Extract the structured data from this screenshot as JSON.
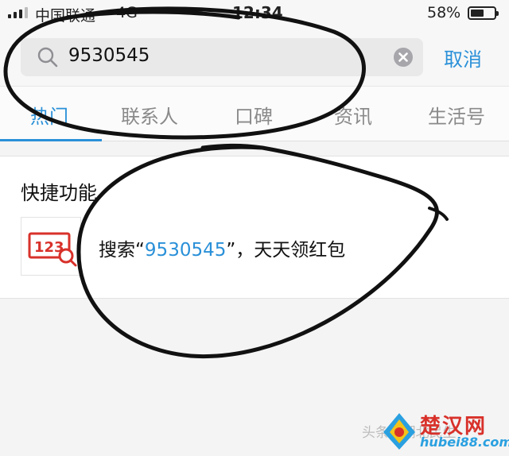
{
  "status_bar": {
    "carrier": "中国联通",
    "network": "4G",
    "time": "12:34",
    "battery_percent": "58%",
    "battery_level": 0.58
  },
  "search": {
    "query": "9530545",
    "cancel_label": "取消",
    "search_icon": "search-icon",
    "clear_icon": "clear-icon"
  },
  "tabs": [
    {
      "label": "热门",
      "active": true
    },
    {
      "label": "联系人",
      "active": false
    },
    {
      "label": "口碑",
      "active": false
    },
    {
      "label": "资讯",
      "active": false
    },
    {
      "label": "生活号",
      "active": false
    }
  ],
  "quick_functions": {
    "title": "快捷功能",
    "item": {
      "icon_label": "123",
      "prefix": "搜索“",
      "highlight": "9530545",
      "suffix": "”，天天领红包"
    }
  },
  "watermark": {
    "text": "头条 / 湖北民生",
    "logo_title": "楚汉网",
    "logo_sub": "hubei88.com"
  },
  "colors": {
    "accent": "#2a90d8",
    "icon_red": "#d8312a",
    "annotation": "#111111"
  }
}
